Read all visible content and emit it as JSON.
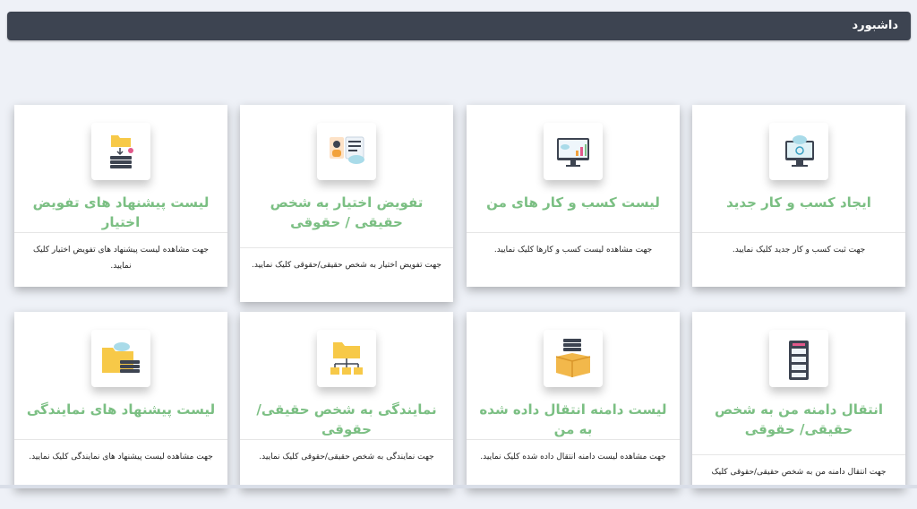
{
  "header": {
    "title": "داشبورد"
  },
  "cards": [
    {
      "title": "ایجاد کسب و کار جدید",
      "description": "جهت ثبت کسب و کار جدید کلیک نمایید.",
      "icon": "monitor-cloud-sync-icon"
    },
    {
      "title": "لیست کسب و کار های من",
      "description": "جهت مشاهده لیست کسب و کارها کلیک نمایید.",
      "icon": "monitor-chart-icon"
    },
    {
      "title": "تفویض اختیار به شخص حقیقی / حقوقی",
      "description": "جهت تفویض اختیار به شخص حقیقی/حقوقی کلیک نمایید.",
      "icon": "person-document-icon"
    },
    {
      "title": "لیست پیشنهاد های تفویض اختیار",
      "description": "جهت مشاهده لیست پیشنهاد های تفویض اختیار کلیک نمایید.",
      "icon": "folder-server-icon"
    },
    {
      "title": "انتقال دامنه من به شخص حقیقی/ حقوقی",
      "description": "جهت انتقال دامنه من به شخص حقیقی/حقوقی کلیک",
      "icon": "server-rack-icon"
    },
    {
      "title": "لیست دامنه انتقال داده شده به من",
      "description": "جهت مشاهده لیست دامنه انتقال داده شده کلیک نمایید.",
      "icon": "box-server-icon"
    },
    {
      "title": "نمایندگی به شخص حقیقی/حقوقی",
      "description": "جهت نمایندگی به شخص حقیقی/حقوقی کلیک نمایید.",
      "icon": "folder-network-icon"
    },
    {
      "title": "لیست پیشنهاد های نمایندگی",
      "description": "جهت مشاهده لیست پیشنهاد های نمایندگی کلیک نمایید.",
      "icon": "folder-cloud-server-icon"
    }
  ]
}
